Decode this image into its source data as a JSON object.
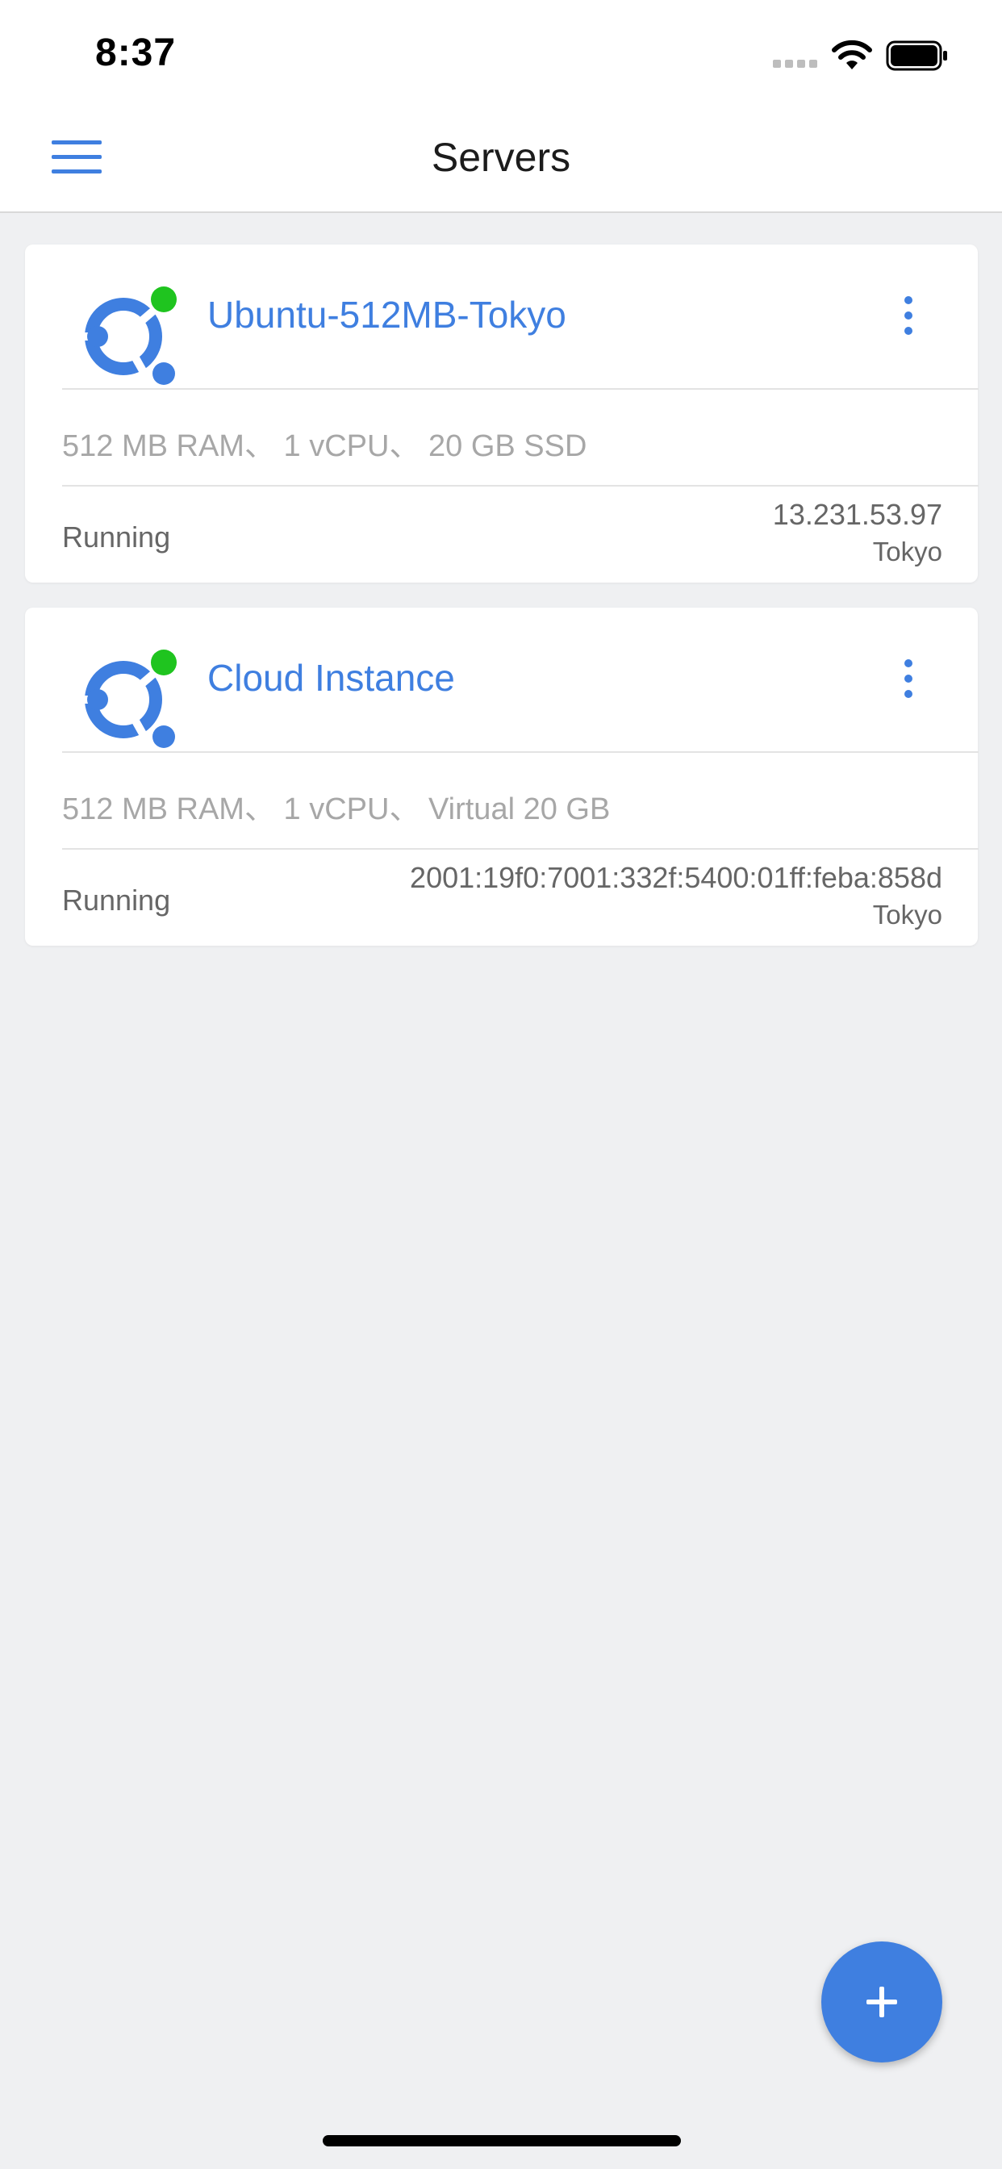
{
  "status_bar": {
    "time": "8:37"
  },
  "nav": {
    "title": "Servers"
  },
  "servers": [
    {
      "name": "Ubuntu-512MB-Tokyo",
      "specs": "512 MB RAM、 1 vCPU、 20 GB SSD",
      "status": "Running",
      "ip": "13.231.53.97",
      "location": "Tokyo",
      "os_icon": "ubuntu-icon",
      "online_indicator_color": "#1fc41f"
    },
    {
      "name": "Cloud Instance",
      "specs": "512 MB RAM、 1 vCPU、 Virtual 20 GB",
      "status": "Running",
      "ip": "2001:19f0:7001:332f:5400:01ff:feba:858d",
      "location": "Tokyo",
      "os_icon": "ubuntu-icon",
      "online_indicator_color": "#1fc41f"
    }
  ],
  "colors": {
    "accent": "#3f7fe0",
    "background": "#eff0f2",
    "online": "#1fc41f"
  }
}
